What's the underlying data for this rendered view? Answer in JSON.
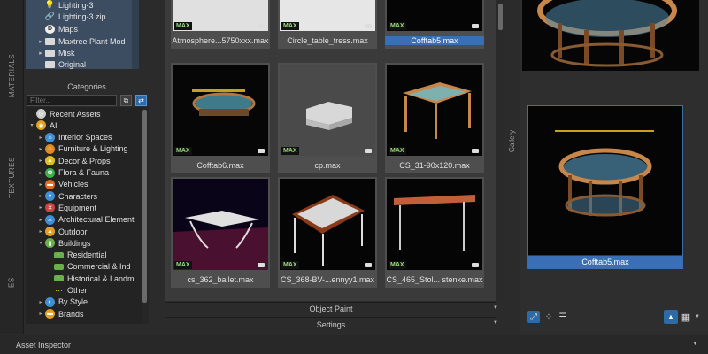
{
  "side_tabs": [
    "MATERIALS",
    "TEXTURES",
    "IES"
  ],
  "top_tree": [
    {
      "label": "Lighting-3",
      "icon": "light-icon",
      "arrow": ""
    },
    {
      "label": "Lighting-3.zip",
      "icon": "zip-icon",
      "arrow": ""
    },
    {
      "label": "Maps",
      "icon": "maps-icon",
      "arrow": ""
    },
    {
      "label": "Maxtree Plant Mod",
      "icon": "folder-icon",
      "arrow": "▸"
    },
    {
      "label": "Misk",
      "icon": "folder-icon",
      "arrow": "▸"
    },
    {
      "label": "Original",
      "icon": "folder-icon",
      "arrow": ""
    }
  ],
  "categories": {
    "title": "Categories",
    "filter_placeholder": "Filter...",
    "items": [
      {
        "label": "Recent Assets",
        "icon": "recent-icon",
        "color": "#cfcfcf",
        "arrow": "",
        "indent": 0
      },
      {
        "label": "AI",
        "icon": "globe-icon",
        "color": "#e0a020",
        "arrow": "▾",
        "indent": 0
      },
      {
        "label": "Interior Spaces",
        "icon": "interior-icon",
        "color": "#3e8fd6",
        "arrow": "▸",
        "indent": 1
      },
      {
        "label": "Furniture & Lighting",
        "icon": "lamp-icon",
        "color": "#e08a20",
        "arrow": "▸",
        "indent": 1
      },
      {
        "label": "Decor & Props",
        "icon": "decor-icon",
        "color": "#e0c020",
        "arrow": "▸",
        "indent": 1
      },
      {
        "label": "Flora & Fauna",
        "icon": "flora-icon",
        "color": "#3fb04a",
        "arrow": "▸",
        "indent": 1
      },
      {
        "label": "Vehicles",
        "icon": "vehicle-icon",
        "color": "#e06a20",
        "arrow": "▸",
        "indent": 1
      },
      {
        "label": "Characters",
        "icon": "character-icon",
        "color": "#3e8fd6",
        "arrow": "▸",
        "indent": 1
      },
      {
        "label": "Equipment",
        "icon": "equipment-icon",
        "color": "#d04040",
        "arrow": "▸",
        "indent": 1
      },
      {
        "label": "Architectural Element",
        "icon": "arch-icon",
        "color": "#3e8fd6",
        "arrow": "▸",
        "indent": 1
      },
      {
        "label": "Outdoor",
        "icon": "outdoor-icon",
        "color": "#e0a020",
        "arrow": "▸",
        "indent": 1
      },
      {
        "label": "Buildings",
        "icon": "building-icon",
        "color": "#6ab04a",
        "arrow": "▾",
        "indent": 1
      },
      {
        "label": "Residential",
        "icon": "residential-icon",
        "color": "#6ab04a",
        "arrow": "",
        "indent": 2
      },
      {
        "label": "Commercial & Ind",
        "icon": "commercial-icon",
        "color": "#6ab04a",
        "arrow": "",
        "indent": 2
      },
      {
        "label": "Historical & Landm",
        "icon": "historical-icon",
        "color": "#6ab04a",
        "arrow": "",
        "indent": 2
      },
      {
        "label": "Other",
        "icon": "other-icon",
        "color": "#e0c020",
        "arrow": "",
        "indent": 2
      },
      {
        "label": "By Style",
        "icon": "style-icon",
        "color": "#3e8fd6",
        "arrow": "▸",
        "indent": 1
      },
      {
        "label": "Brands",
        "icon": "brands-icon",
        "color": "#e0a020",
        "arrow": "▸",
        "indent": 1
      }
    ]
  },
  "grid": {
    "badge": "MAX",
    "tiles": [
      {
        "label": "Atmosphere...5750xxx.max",
        "selected": false,
        "thumb": "white"
      },
      {
        "label": "Circle_table_tress.max",
        "selected": false,
        "thumb": "circle"
      },
      {
        "label": "Cofftab5.max",
        "selected": true,
        "thumb": "cofftab5"
      },
      {
        "label": "Cofftab6.max",
        "selected": false,
        "thumb": "cofftab6"
      },
      {
        "label": "cp.max",
        "selected": false,
        "thumb": "cp"
      },
      {
        "label": "CS_31-90x120.max",
        "selected": false,
        "thumb": "cs31"
      },
      {
        "label": "cs_362_ballet.max",
        "selected": false,
        "thumb": "cs362"
      },
      {
        "label": "CS_368-BV-...ennyy1.max",
        "selected": false,
        "thumb": "cs368"
      },
      {
        "label": "CS_465_Stol... stenke.max",
        "selected": false,
        "thumb": "cs465"
      }
    ]
  },
  "bottom_bars": {
    "object_paint": "Object Paint",
    "settings": "Settings"
  },
  "gallery": {
    "tab_label": "Gallery",
    "selected_label": "Cofftab5.max"
  },
  "asset_inspector": "Asset Inspector",
  "colors": {
    "accent": "#3a6eb5",
    "tree_bg": "#3c4d62"
  }
}
